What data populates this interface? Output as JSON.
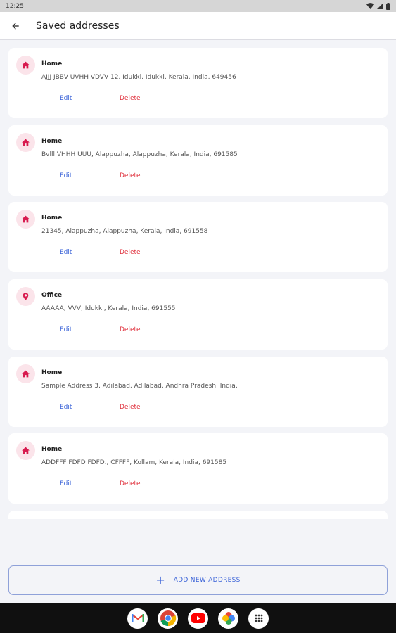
{
  "status_bar": {
    "time": "12:25"
  },
  "header": {
    "title": "Saved addresses"
  },
  "addresses": [
    {
      "label": "Home",
      "icon": "home-icon",
      "address": "AJJJ JBBV UVHH VDVV 12, Idukki, Idukki, Kerala, India, 649456",
      "edit": "Edit",
      "delete": "Delete"
    },
    {
      "label": "Home",
      "icon": "home-icon",
      "address": "Bvlll VHHH UUU, Alappuzha, Alappuzha, Kerala, India, 691585",
      "edit": "Edit",
      "delete": "Delete"
    },
    {
      "label": "Home",
      "icon": "home-icon",
      "address": "21345, Alappuzha, Alappuzha, Kerala, India, 691558",
      "edit": "Edit",
      "delete": "Delete"
    },
    {
      "label": "Office",
      "icon": "location-pin-icon",
      "address": "AAAAA, VVV, Idukki, Kerala, India, 691555",
      "edit": "Edit",
      "delete": "Delete"
    },
    {
      "label": "Home",
      "icon": "home-icon",
      "address": "Sample Address 3, Adilabad, Adilabad, Andhra Pradesh, India,",
      "edit": "Edit",
      "delete": "Delete"
    },
    {
      "label": "Home",
      "icon": "home-icon",
      "address": "ADDFFF FDFD FDFD., CFFFF, Kollam, Kerala, India, 691585",
      "edit": "Edit",
      "delete": "Delete"
    }
  ],
  "add_button": {
    "label": "ADD NEW ADDRESS"
  },
  "dock_apps": [
    "gmail-icon",
    "chrome-icon",
    "youtube-icon",
    "photos-icon",
    "app-drawer-icon"
  ],
  "colors": {
    "accent": "#3c64d8",
    "delete": "#e0313d",
    "icon": "#d81b4f",
    "icon_bg": "#fbe4ea"
  }
}
